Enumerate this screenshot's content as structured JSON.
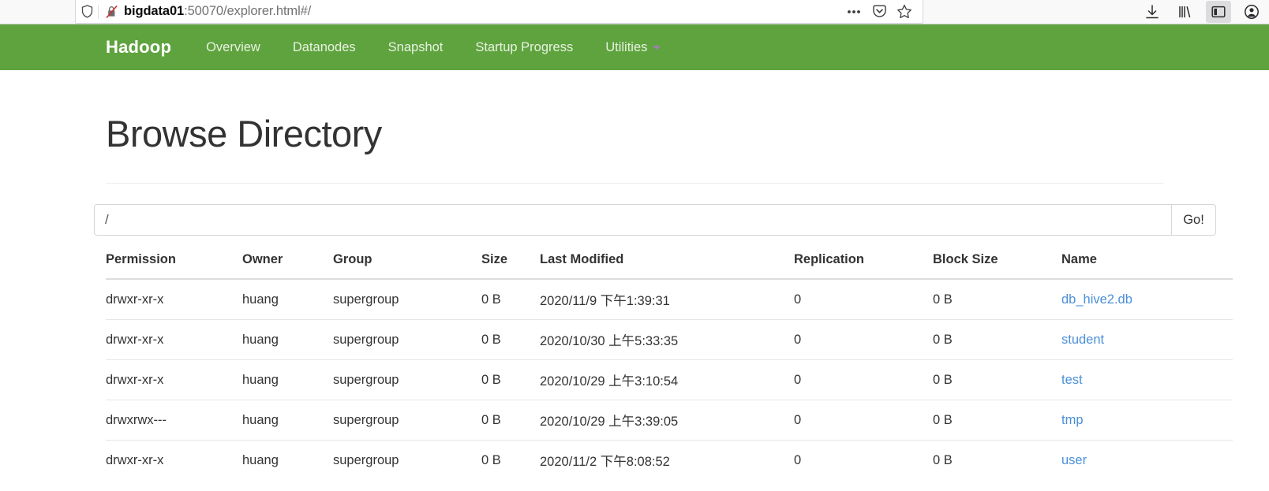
{
  "browser": {
    "url_host": "bigdata01",
    "url_rest": ":50070/explorer.html#/",
    "icons": {
      "shield": "shield-icon",
      "lock_broken": "broken-lock-icon",
      "page_actions": "ellipsis-icon",
      "pocket": "pocket-icon",
      "bookmark": "star-icon",
      "downloads": "download-icon",
      "library": "library-icon",
      "sidebar": "sidebar-toggle-icon",
      "account": "account-icon"
    }
  },
  "navbar": {
    "brand": "Hadoop",
    "background_color": "#5fa33e",
    "items": [
      {
        "label": "Overview"
      },
      {
        "label": "Datanodes"
      },
      {
        "label": "Snapshot"
      },
      {
        "label": "Startup Progress"
      },
      {
        "label": "Utilities",
        "has_caret": true
      }
    ]
  },
  "main": {
    "title": "Browse Directory",
    "path_input": {
      "value": "/",
      "placeholder": ""
    },
    "go_button": "Go!",
    "link_color": "#4a90d9"
  },
  "table": {
    "headers": [
      "Permission",
      "Owner",
      "Group",
      "Size",
      "Last Modified",
      "Replication",
      "Block Size",
      "Name"
    ],
    "rows": [
      {
        "permission": "drwxr-xr-x",
        "owner": "huang",
        "group": "supergroup",
        "size": "0 B",
        "last_modified": "2020/11/9 下午1:39:31",
        "replication": "0",
        "block_size": "0 B",
        "name": "db_hive2.db"
      },
      {
        "permission": "drwxr-xr-x",
        "owner": "huang",
        "group": "supergroup",
        "size": "0 B",
        "last_modified": "2020/10/30 上午5:33:35",
        "replication": "0",
        "block_size": "0 B",
        "name": "student"
      },
      {
        "permission": "drwxr-xr-x",
        "owner": "huang",
        "group": "supergroup",
        "size": "0 B",
        "last_modified": "2020/10/29 上午3:10:54",
        "replication": "0",
        "block_size": "0 B",
        "name": "test"
      },
      {
        "permission": "drwxrwx---",
        "owner": "huang",
        "group": "supergroup",
        "size": "0 B",
        "last_modified": "2020/10/29 上午3:39:05",
        "replication": "0",
        "block_size": "0 B",
        "name": "tmp"
      },
      {
        "permission": "drwxr-xr-x",
        "owner": "huang",
        "group": "supergroup",
        "size": "0 B",
        "last_modified": "2020/11/2 下午8:08:52",
        "replication": "0",
        "block_size": "0 B",
        "name": "user"
      }
    ]
  }
}
